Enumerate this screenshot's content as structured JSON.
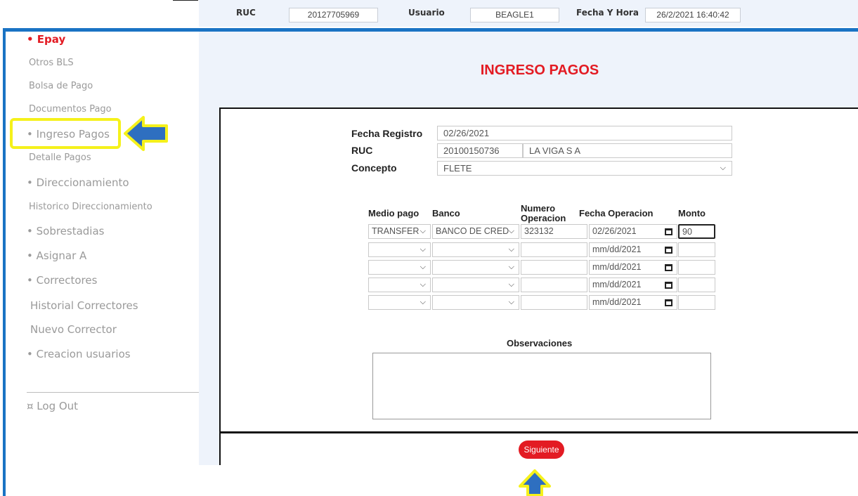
{
  "header": {
    "ruc_label": "RUC",
    "ruc_value": "20127705969",
    "usuario_label": "Usuario",
    "usuario_value": "BEAGLE1",
    "fecha_label": "Fecha Y Hora",
    "fecha_value": "26/2/2021 16:40:42"
  },
  "sidebar": {
    "items": [
      {
        "label": "• Epay"
      },
      {
        "label": "Otros BLS"
      },
      {
        "label": "Bolsa de Pago"
      },
      {
        "label": "Documentos Pago"
      },
      {
        "label": "• Ingreso Pagos"
      },
      {
        "label": "Detalle Pagos"
      },
      {
        "label": "• Direccionamiento"
      },
      {
        "label": "Historico Direccionamiento"
      },
      {
        "label": "• Sobrestadias"
      },
      {
        "label": "• Asignar A"
      },
      {
        "label": "• Correctores"
      },
      {
        "label": "Historial Correctores"
      },
      {
        "label": "Nuevo Corrector"
      },
      {
        "label": "• Creacion usuarios"
      }
    ],
    "logout_label": "¤ Log Out"
  },
  "page": {
    "title": "INGRESO PAGOS"
  },
  "form": {
    "fecha_registro_label": "Fecha Registro",
    "fecha_registro_value": "02/26/2021",
    "ruc_label": "RUC",
    "ruc_value": "20100150736",
    "razon_social_value": "LA VIGA S A",
    "concepto_label": "Concepto",
    "concepto_value": "FLETE"
  },
  "payments": {
    "headers": {
      "medio": "Medio pago",
      "banco": "Banco",
      "numero_line1": "Numero",
      "numero_line2": "Operacion",
      "fecha": "Fecha Operacion",
      "monto": "Monto"
    },
    "rows": [
      {
        "medio": "TRANSFER",
        "banco": "BANCO DE CRED",
        "numero": "323132",
        "fecha": "02/26/2021",
        "monto": "90"
      },
      {
        "medio": "",
        "banco": "",
        "numero": "",
        "fecha": "mm/dd/2021",
        "monto": ""
      },
      {
        "medio": "",
        "banco": "",
        "numero": "",
        "fecha": "mm/dd/2021",
        "monto": ""
      },
      {
        "medio": "",
        "banco": "",
        "numero": "",
        "fecha": "mm/dd/2021",
        "monto": ""
      },
      {
        "medio": "",
        "banco": "",
        "numero": "",
        "fecha": "mm/dd/2021",
        "monto": ""
      }
    ]
  },
  "observaciones": {
    "label": "Observaciones",
    "value": ""
  },
  "actions": {
    "siguiente_label": "Siguiente"
  },
  "icons": {
    "dropdown": "chevron-down-icon",
    "calendar": "calendar-icon",
    "annotation_arrow": "arrow-icon"
  },
  "colors": {
    "brand_red": "#e31b23",
    "frame_blue": "#1a73c4",
    "highlight_yellow": "#f5f11b",
    "annotation_arrow_blue": "#2e6fc0"
  }
}
